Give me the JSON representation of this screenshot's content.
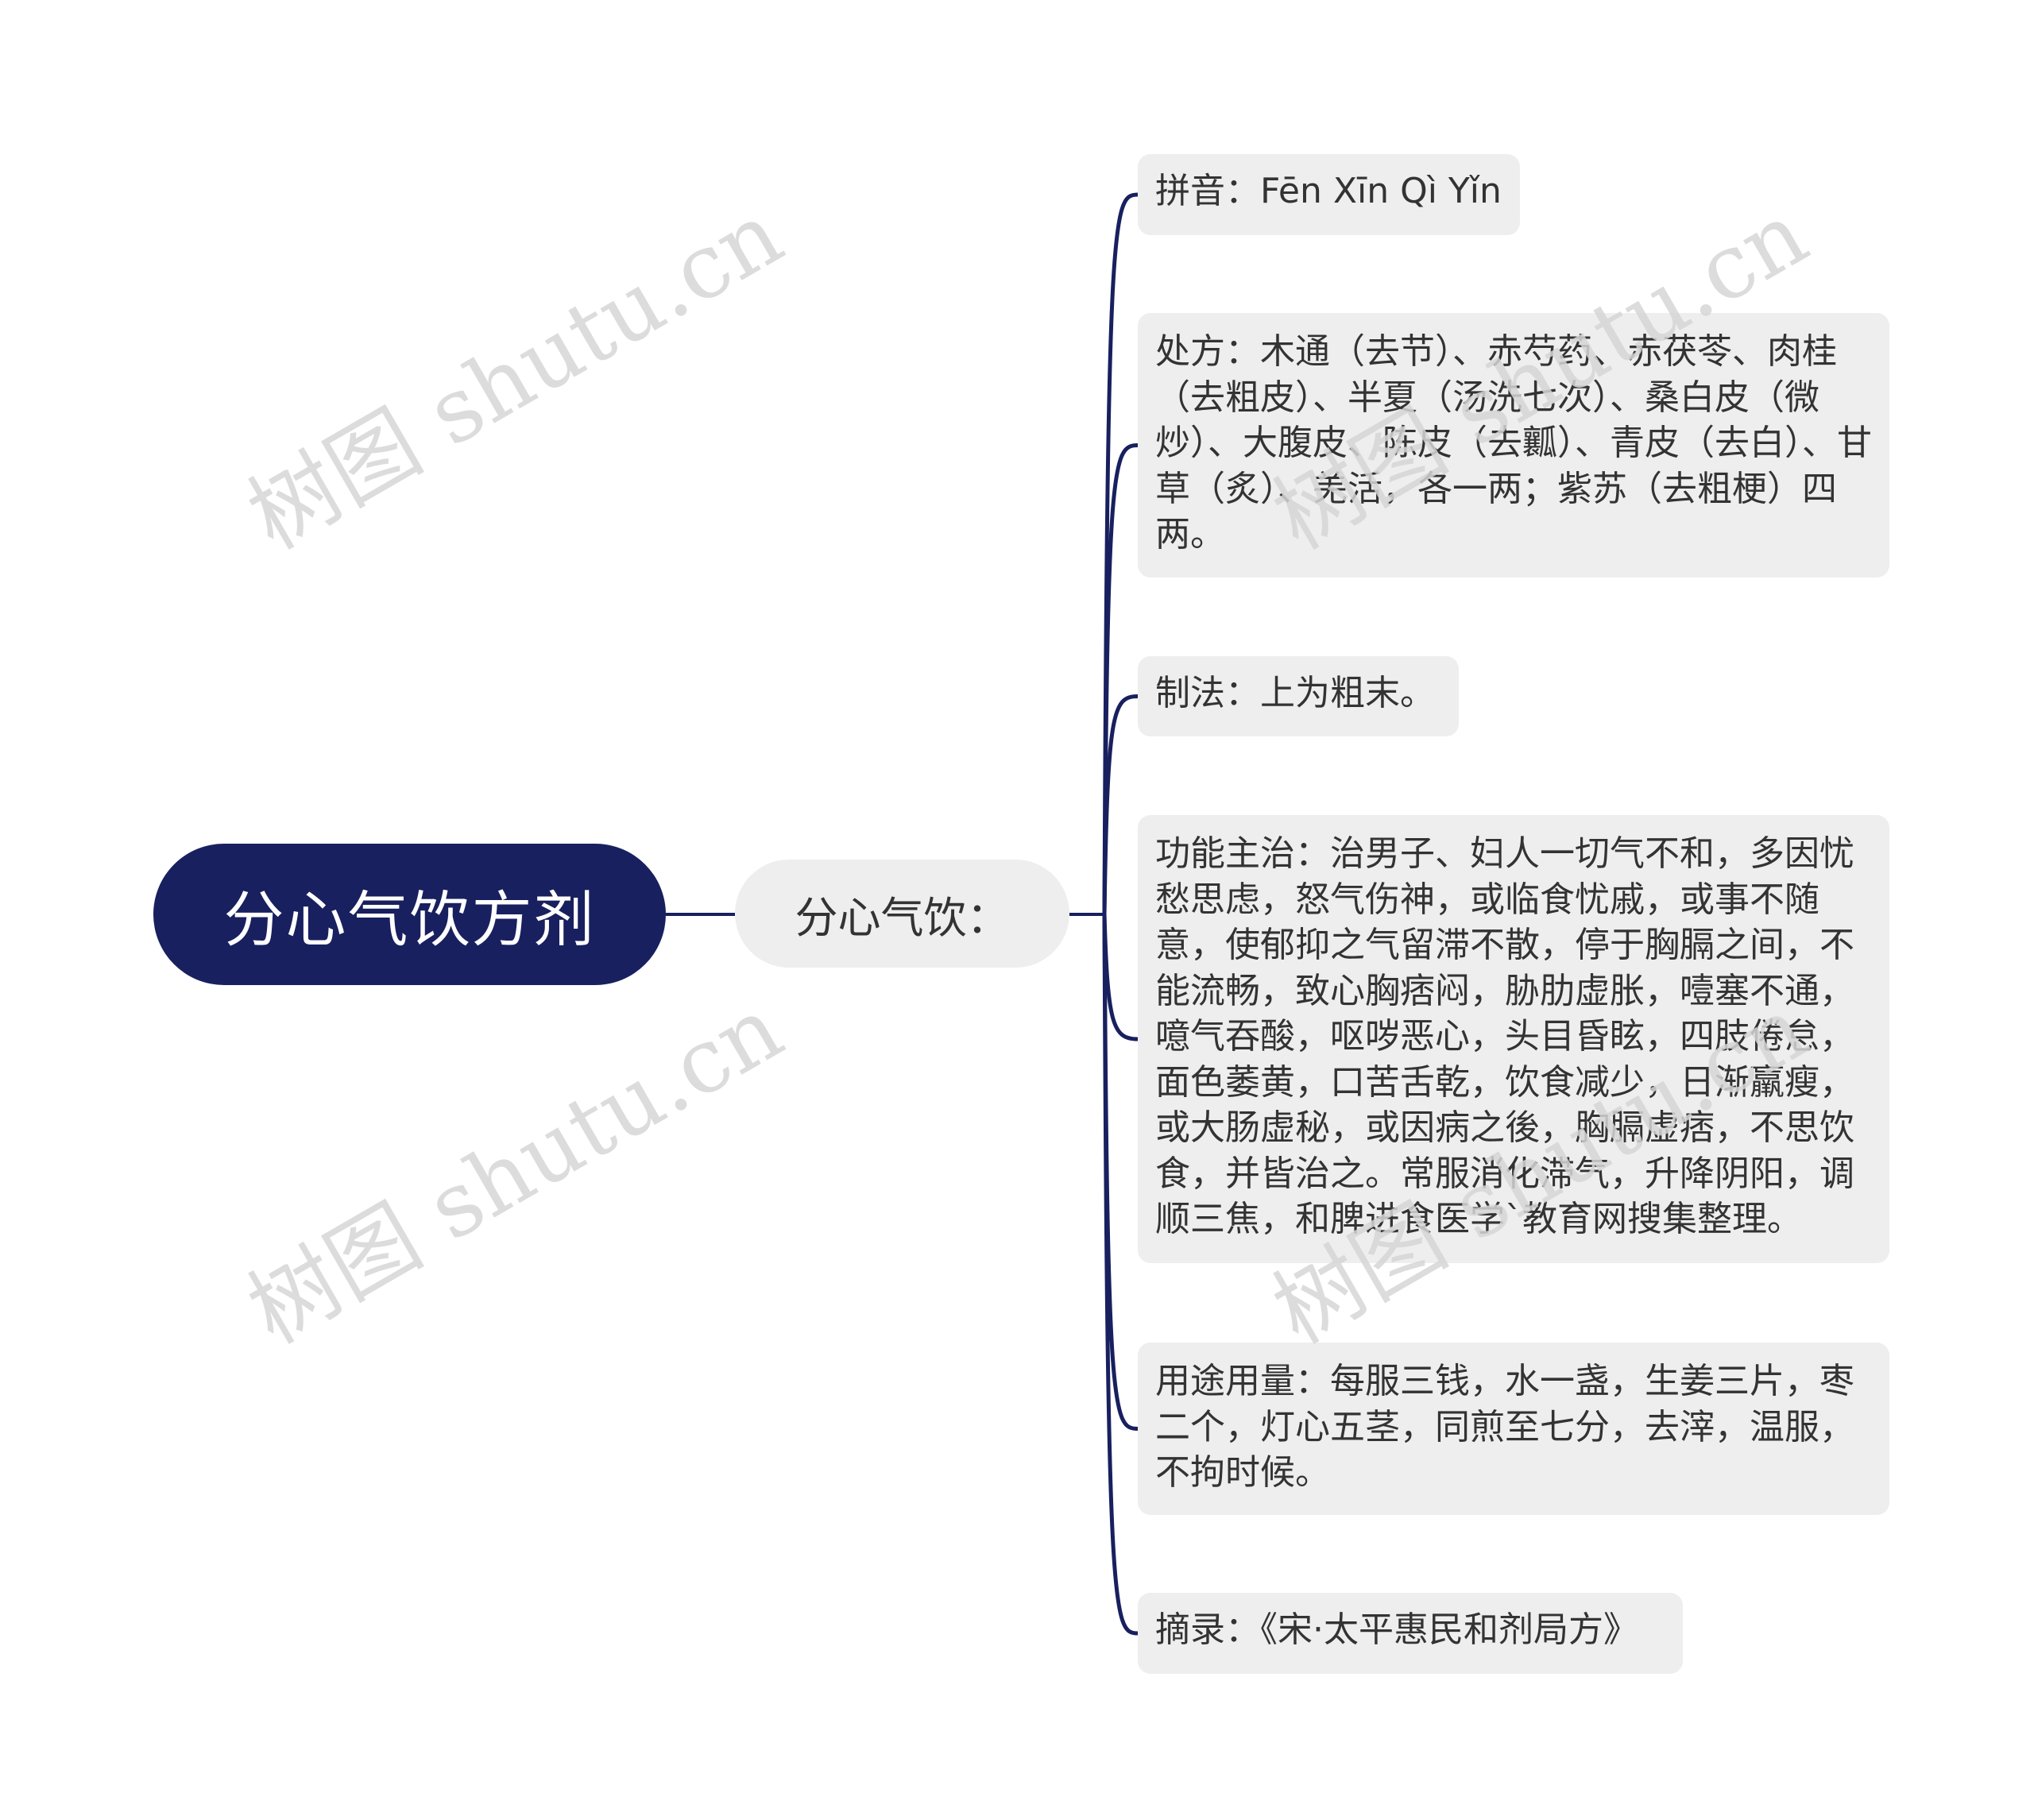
{
  "root": {
    "label": "分心气饮方剂"
  },
  "middle": {
    "label": "分心气饮："
  },
  "leaves": [
    {
      "key": "pinyin",
      "text": "拼音：Fēn Xīn Qì Yǐn"
    },
    {
      "key": "prescription",
      "text": "处方：木通（去节）、赤芍药、赤茯苓、肉桂（去粗皮）、半夏（汤洗七次）、桑白皮（微炒）、大腹皮、陈皮（去瓤）、青皮（去白）、甘草（炙）、羌活，各一两；紫苏（去粗梗）四两。"
    },
    {
      "key": "preparation",
      "text": "制法：上为粗末。"
    },
    {
      "key": "indications",
      "text": "功能主治：治男子、妇人一切气不和，多因忧愁思虑，怒气伤神，或临食忧戚，或事不随意，使郁抑之气留滞不散，停于胸膈之间，不能流畅，致心胸痞闷，胁肋虚胀，噎塞不通，噫气吞酸，呕哕恶心，头目昏眩，四肢倦怠，面色萎黄，口苦舌乾，饮食减少，日渐羸瘦，或大肠虚秘，或因病之後，胸膈虚痞，不思饮食，并皆治之。常服消化滞气，升降阴阳，调顺三焦，和脾进食医学`教育网搜集整理。"
    },
    {
      "key": "usage",
      "text": "用途用量：每服三钱，水一盏，生姜三片，枣二个，灯心五茎，同煎至七分，去滓，温服，不拘时候。"
    },
    {
      "key": "source",
      "text": "摘录：《宋·太平惠民和剂局方》"
    }
  ],
  "watermark": {
    "text": "树图 shutu.cn"
  },
  "colors": {
    "root_fill": "#18205f",
    "node_fill": "#eeeeee",
    "connector": "#18205f",
    "text": "#333333"
  }
}
